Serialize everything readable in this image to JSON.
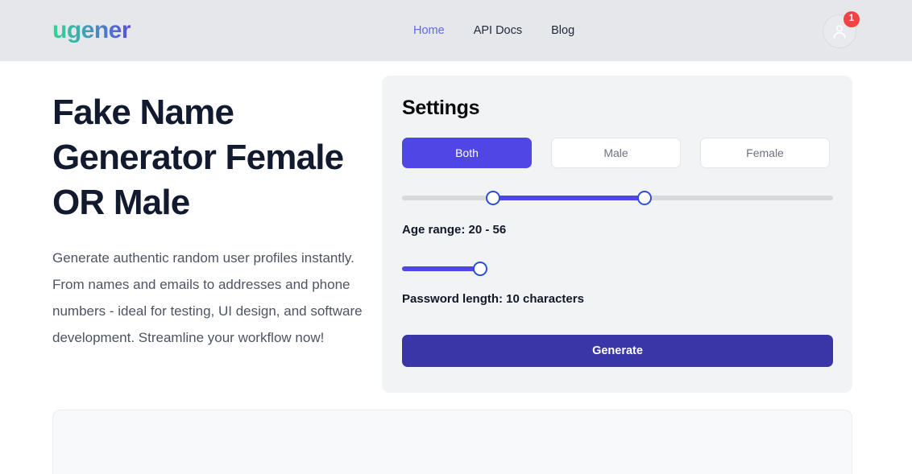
{
  "header": {
    "logo_text": "ugener",
    "nav": [
      {
        "label": "Home",
        "active": true
      },
      {
        "label": "API Docs",
        "active": false
      },
      {
        "label": "Blog",
        "active": false
      }
    ],
    "avatar_icon": "user-avatar-icon",
    "notification_count": "1"
  },
  "hero": {
    "title": "Fake Name Generator Female OR Male",
    "description": "Generate authentic random user profiles instantly. From names and emails to addresses and phone numbers - ideal for testing, UI design, and software development. Streamline your workflow now!"
  },
  "settings": {
    "title": "Settings",
    "gender_options": [
      {
        "label": "Both",
        "selected": true
      },
      {
        "label": "Male",
        "selected": false
      },
      {
        "label": "Female",
        "selected": false
      }
    ],
    "age_slider": {
      "min_value": "20",
      "max_value": "56",
      "label": "Age range: 20 - 56"
    },
    "password_slider": {
      "value": "10",
      "label": "Password length: 10 characters"
    },
    "generate_label": "Generate"
  },
  "colors": {
    "accent": "#4f46e5",
    "accent_dark": "#3b36a8",
    "badge": "#ef4444",
    "nav_active": "#6366f1",
    "header_bg": "#e5e7eb",
    "panel_bg": "#f1f3f5"
  }
}
